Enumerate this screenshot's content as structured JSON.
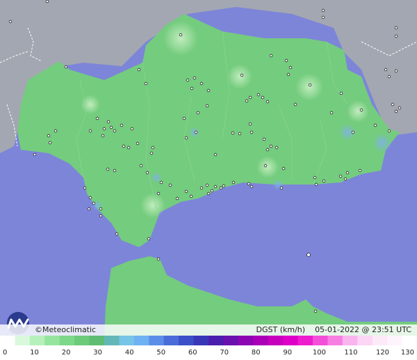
{
  "credit": "©Meteoclimatic",
  "variable": "DGST (km/h)",
  "timestamp": "05-01-2022 @ 23:51 UTC",
  "scale": {
    "ticks": [
      "0",
      "10",
      "20",
      "30",
      "40",
      "50",
      "60",
      "70",
      "80",
      "90",
      "100",
      "110",
      "120",
      "130"
    ],
    "colors": [
      "#ffffff",
      "#d9f8dc",
      "#b6f1bb",
      "#96e59e",
      "#7ed889",
      "#6ccb7b",
      "#5fbc73",
      "#63b8b7",
      "#76c4e6",
      "#6fb1f2",
      "#5c8ee9",
      "#4a6cd8",
      "#3b4fc8",
      "#3a36b8",
      "#4a1fb0",
      "#6a12ad",
      "#8d06b3",
      "#a900b8",
      "#c600bd",
      "#de00c8",
      "#ee1ecf",
      "#f44fd8",
      "#f77fe2",
      "#fab4ee",
      "#fcd6f4",
      "#fdeaf9",
      "#fef4fc",
      "#ffffff"
    ]
  },
  "colors": {
    "sea": "#7d85d9",
    "land": "#74cc7e",
    "land_outside": "#a3a7b1",
    "station": "#222222"
  }
}
